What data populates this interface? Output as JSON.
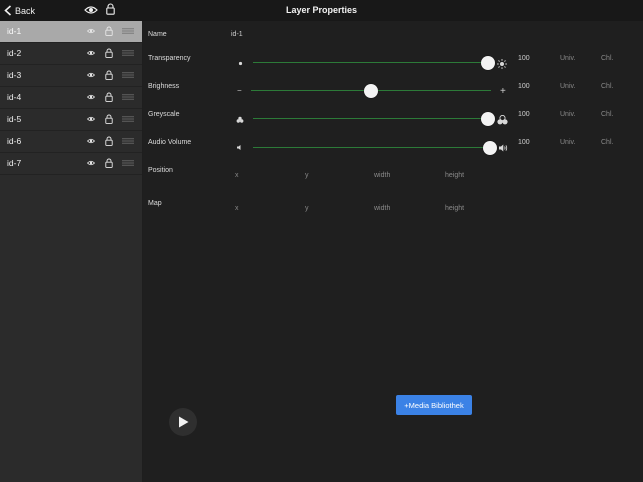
{
  "header": {
    "back_label": "Back",
    "title": "Layer Properties"
  },
  "layers": [
    {
      "name": "id-1",
      "selected": true
    },
    {
      "name": "id-2",
      "selected": false
    },
    {
      "name": "id-3",
      "selected": false
    },
    {
      "name": "id-4",
      "selected": false
    },
    {
      "name": "id-5",
      "selected": false
    },
    {
      "name": "id-6",
      "selected": false
    },
    {
      "name": "id-7",
      "selected": false
    }
  ],
  "properties": {
    "name_label": "Name",
    "name_value": "id-1",
    "transparency": {
      "label": "Transparency",
      "value": "100",
      "univ": "Univ.",
      "chl": "Chl.",
      "level": 0.975
    },
    "brightness": {
      "label": "Brighness",
      "value": "100",
      "univ": "Univ.",
      "chl": "Chl.",
      "level": 0.5
    },
    "greyscale": {
      "label": "Greyscale",
      "value": "100",
      "univ": "Univ.",
      "chl": "Chl.",
      "level": 0.975
    },
    "audio_volume": {
      "label": "Audio Volume",
      "value": "100",
      "univ": "Univ.",
      "chl": "Chl.",
      "level": 0.975
    },
    "position": {
      "label": "Position",
      "x": "x",
      "y": "y",
      "width": "width",
      "height": "height"
    },
    "map": {
      "label": "Map",
      "x": "x",
      "y": "y",
      "width": "width",
      "height": "height"
    }
  },
  "icons": {
    "brightness_minus": "−",
    "brightness_plus": "+"
  },
  "buttons": {
    "media_library": "+Media Bibliothek"
  },
  "colors": {
    "accent": "#3b82e6",
    "slider_track": "#2c7a38",
    "selected_row": "#a9a9a9"
  }
}
